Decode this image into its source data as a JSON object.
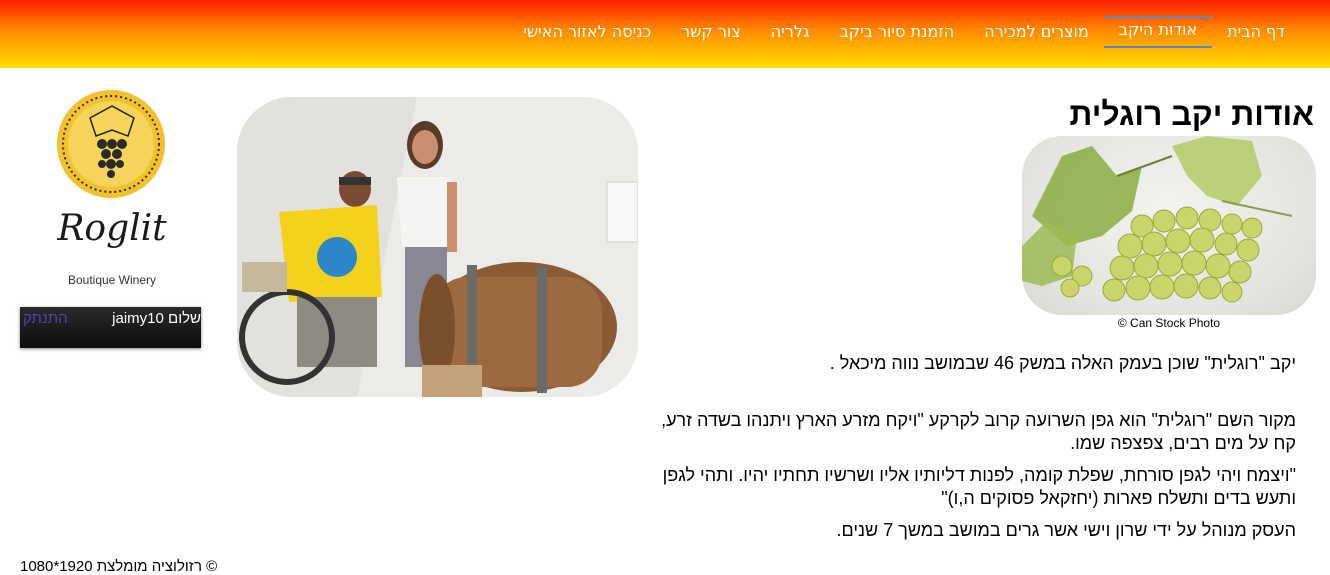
{
  "nav": {
    "items": [
      {
        "label": "דף הבית"
      },
      {
        "label": "אודות היקב"
      },
      {
        "label": "מוצרים למכירה"
      },
      {
        "label": "הזמנת סיור ביקב"
      },
      {
        "label": "גלריה"
      },
      {
        "label": "צור קשר"
      },
      {
        "label": "כניסה לאזור האישי"
      }
    ],
    "active_index": 1
  },
  "page": {
    "title": "אודות יקב רוגלית",
    "image_caption": "© Can Stock Photo",
    "paragraphs": [
      "יקב \"רוגלית\" שוכן בעמק האלה במשק 46 שבמושב נווה מיכאל .",
      "מקור השם \"רוגלית\" הוא גפן השרועה קרוב לקרקע \"ויקח מזרע הארץ ויתנהו בשדה זרע, קח על מים רבים, צפצפה שמו.",
      "\"ויצמח ויהי לגפן סורחת, שפלת קומה, לפנות דליותיו אליו ושרשיו תחתיו יהיו. ותהי לגפן ותעש בדים ותשלח פארות (יחזקאל פסוקים ה,ו)\"",
      "העסק מנוהל על ידי שרון וישי אשר גרים במושב במשך 7 שנים."
    ]
  },
  "logo": {
    "brand": "Roglit",
    "tagline": "Boutique Winery"
  },
  "user": {
    "greeting": "שלום jaimy10",
    "logout_label": "התנתק"
  },
  "footer": {
    "text": "© רזולוציה מומלצת 1920*1080"
  },
  "colors": {
    "nav_top": "#ff1f00",
    "nav_bottom": "#ffe000",
    "active_border": "#5b87c7",
    "logout_link": "#5a3fb0"
  }
}
